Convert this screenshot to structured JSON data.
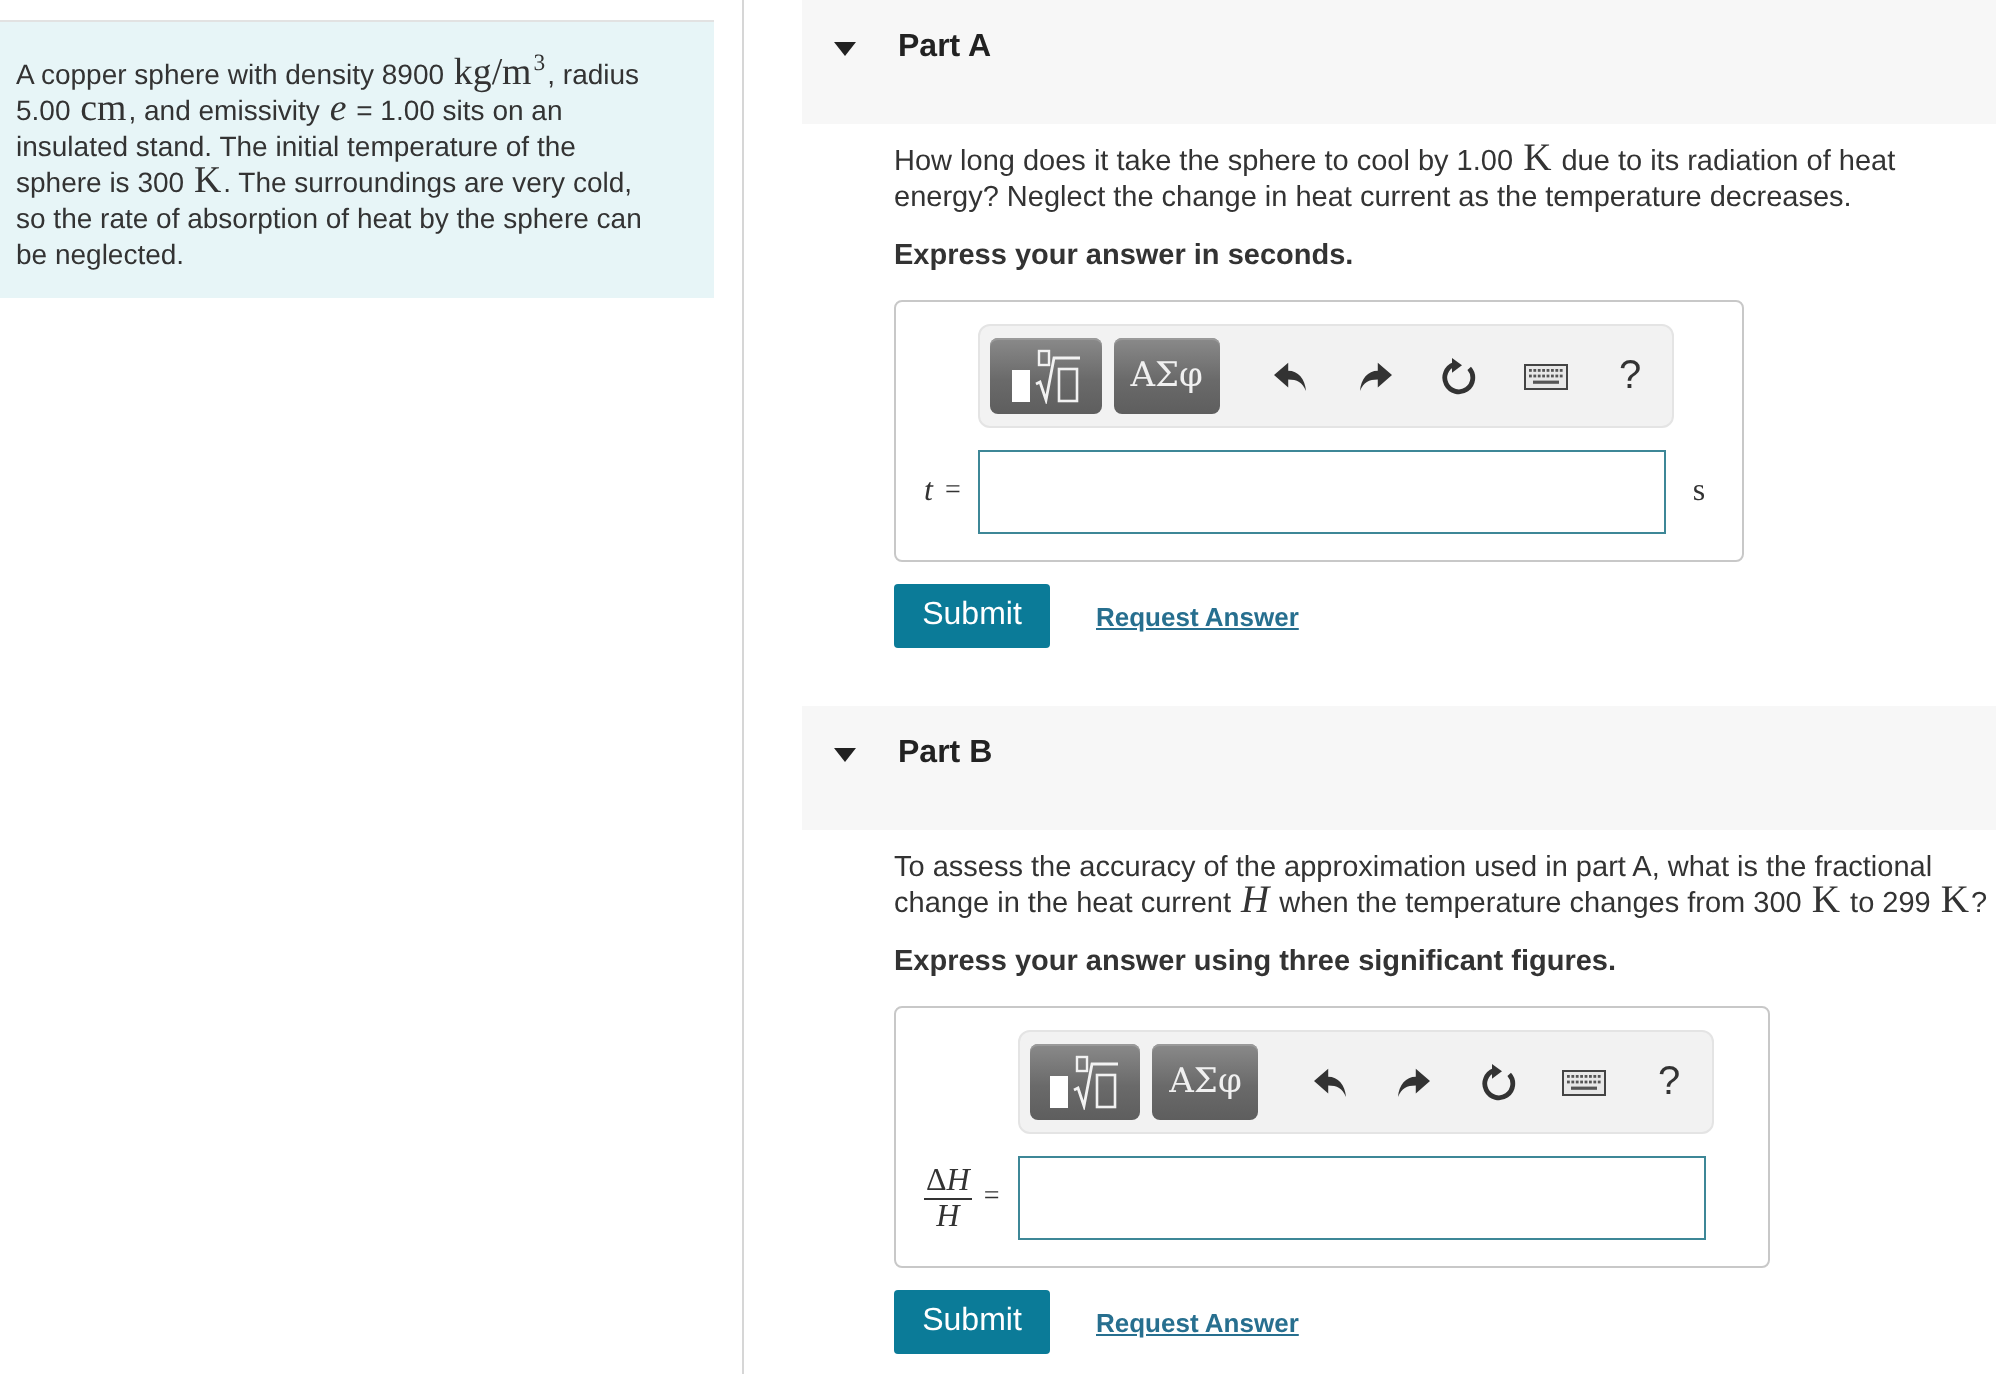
{
  "problem": {
    "segments": [
      {
        "kind": "text",
        "text": "A copper sphere with density 8900 "
      },
      {
        "kind": "math",
        "text": "kg/m$^{3}$"
      },
      {
        "kind": "text",
        "text": ", radius 5.00 "
      },
      {
        "kind": "math",
        "text": "cm"
      },
      {
        "kind": "text",
        "text": ", and emissivity "
      },
      {
        "kind": "math",
        "text": "*e*"
      },
      {
        "kind": "text",
        "text": " = 1.00 sits on an insulated stand. The initial temperature of the sphere is 300 "
      },
      {
        "kind": "math",
        "text": "K"
      },
      {
        "kind": "text",
        "text": ". The surroundings are very cold, so the rate of absorption of heat by the sphere can be neglected."
      }
    ]
  },
  "parts": [
    {
      "title": "Part A",
      "expanded": true,
      "question": [
        {
          "kind": "text",
          "text": "How long does it take the sphere to cool by 1.00 "
        },
        {
          "kind": "math",
          "text": "K"
        },
        {
          "kind": "text",
          "text": " due to its radiation of heat energy? Neglect the change in heat current as the temperature decreases."
        }
      ],
      "instruction": "Express your answer in seconds.",
      "toolbar": [
        {
          "kind": "templates"
        },
        {
          "kind": "symbols",
          "text": "ΑΣφ"
        },
        {
          "kind": "undo"
        },
        {
          "kind": "redo"
        },
        {
          "kind": "reset"
        },
        {
          "kind": "keyboard"
        },
        {
          "kind": "help",
          "text": "?"
        }
      ],
      "answer": {
        "label": {
          "kind": "inline",
          "parts": [
            {
              "kind": "variable",
              "text": "t"
            }
          ],
          "equals": "="
        },
        "unit": "s"
      },
      "actions": [
        {
          "kind": "submit",
          "label": "Submit"
        },
        {
          "kind": "link",
          "label": "Request Answer"
        }
      ]
    },
    {
      "title": "Part B",
      "expanded": true,
      "question": [
        {
          "kind": "text",
          "text": "To assess the accuracy of the approximation used in part A, what is the fractional change in the heat current "
        },
        {
          "kind": "math",
          "text": "*H*"
        },
        {
          "kind": "text",
          "text": " when the temperature changes from 300 "
        },
        {
          "kind": "math",
          "text": "K"
        },
        {
          "kind": "text",
          "text": " to 299 "
        },
        {
          "kind": "math",
          "text": "K"
        },
        {
          "kind": "text",
          "text": "?"
        }
      ],
      "instruction": "Express your answer using three significant figures.",
      "toolbar": [
        {
          "kind": "templates"
        },
        {
          "kind": "symbols",
          "text": "ΑΣφ"
        },
        {
          "kind": "undo"
        },
        {
          "kind": "redo"
        },
        {
          "kind": "reset"
        },
        {
          "kind": "keyboard"
        },
        {
          "kind": "help",
          "text": "?"
        }
      ],
      "answer": {
        "label": {
          "kind": "fraction",
          "numerator": [
            {
              "kind": "symbol",
              "text": "Δ"
            },
            {
              "kind": "variable",
              "text": "H"
            }
          ],
          "denominator": [
            {
              "kind": "variable",
              "text": "H"
            }
          ],
          "equals": "="
        }
      },
      "actions": [
        {
          "kind": "submit",
          "label": "Submit"
        },
        {
          "kind": "link",
          "label": "Request Answer"
        }
      ]
    }
  ]
}
